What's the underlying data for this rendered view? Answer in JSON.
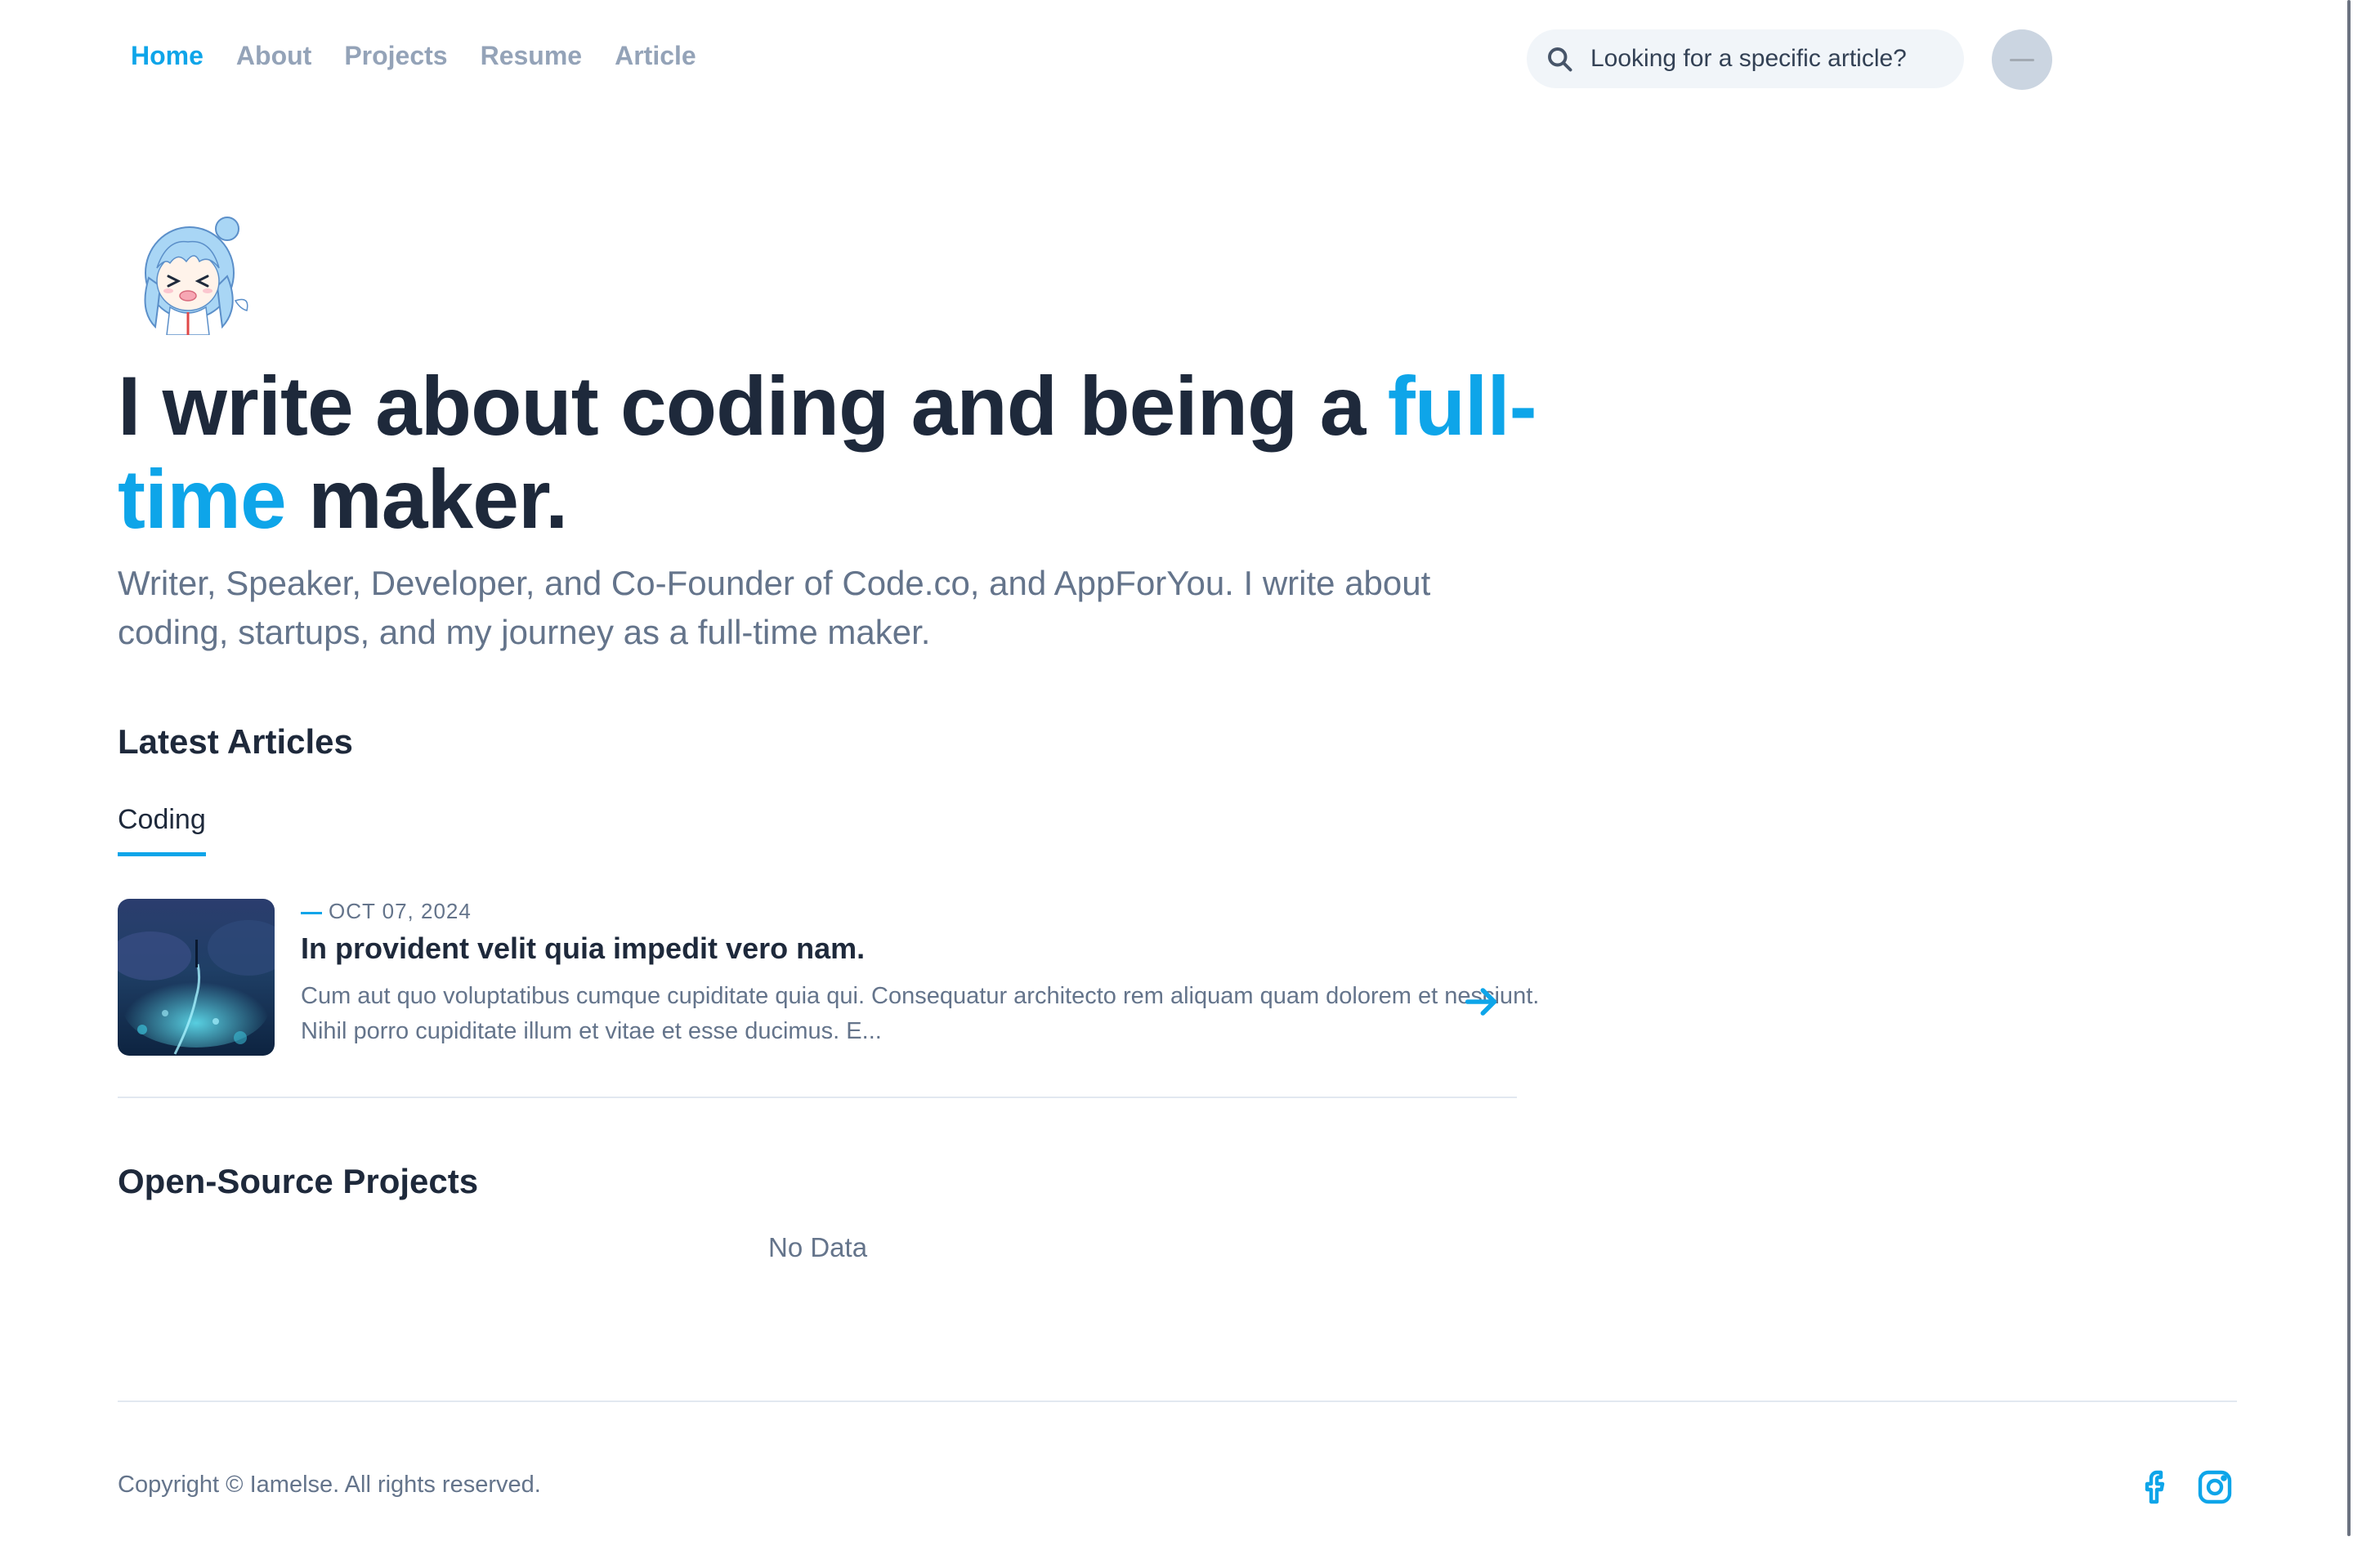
{
  "nav": {
    "items": [
      {
        "label": "Home",
        "active": true
      },
      {
        "label": "About",
        "active": false
      },
      {
        "label": "Projects",
        "active": false
      },
      {
        "label": "Resume",
        "active": false
      },
      {
        "label": "Article",
        "active": false
      }
    ]
  },
  "search": {
    "placeholder": "Looking for a specific article?",
    "icon": "search-icon"
  },
  "hero": {
    "headline_before": "I write about coding and being a ",
    "headline_accent": "full-time",
    "headline_after": " maker.",
    "subtitle": "Writer, Speaker, Developer, and Co-Founder of Code.co, and AppForYou. I write about coding, startups, and my journey as a full-time maker."
  },
  "articles": {
    "section_title": "Latest Articles",
    "tab_label": "Coding",
    "items": [
      {
        "date": "OCT 07, 2024",
        "title": "In provident velit quia impedit vero nam.",
        "excerpt": "Cum aut quo voluptatibus cumque cupiditate quia qui. Consequatur architecto rem aliquam quam dolorem et nesciunt. Nihil porro cupiditate illum et vitae et esse ducimus. E..."
      }
    ]
  },
  "projects": {
    "section_title": "Open-Source Projects",
    "empty_text": "No Data"
  },
  "footer": {
    "copyright": "Copyright © Iamelse. All rights reserved.",
    "social": [
      "facebook-icon",
      "instagram-icon"
    ]
  },
  "colors": {
    "accent": "#0ea5e9",
    "heading": "#1e293b",
    "muted": "#64748b",
    "nav_inactive": "#94a3b8"
  }
}
